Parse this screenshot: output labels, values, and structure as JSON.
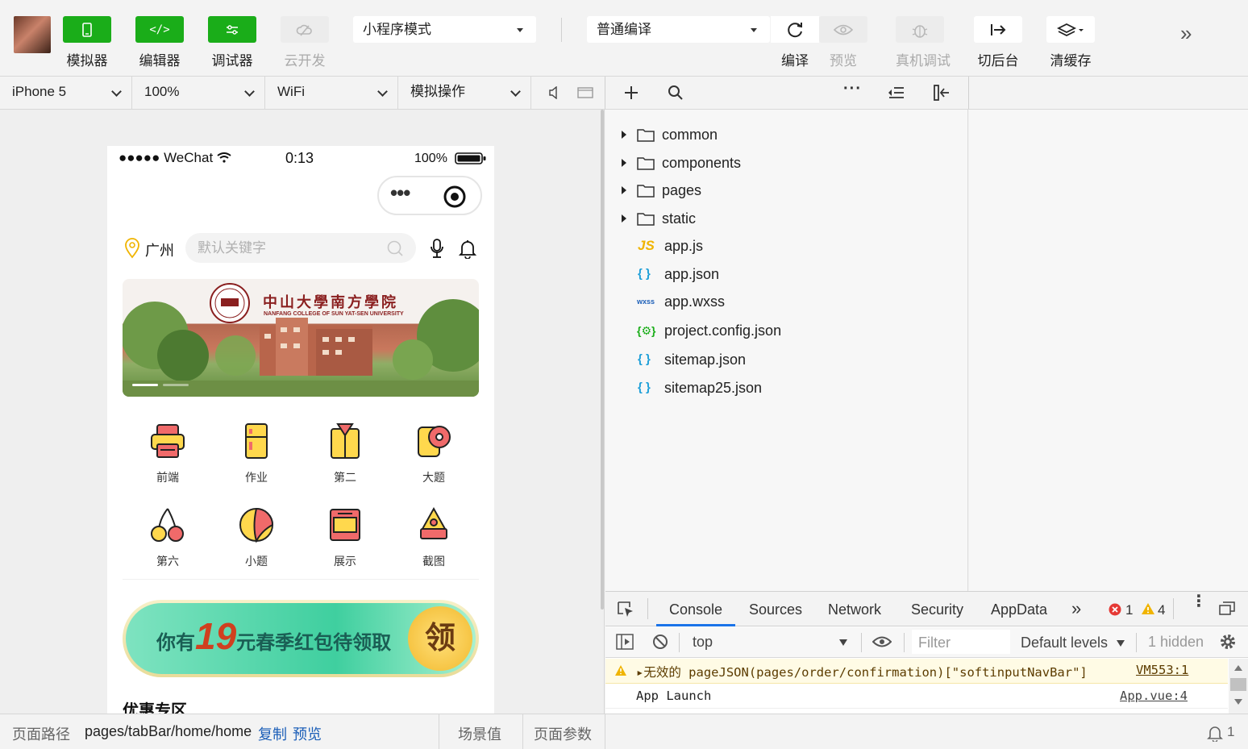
{
  "toolbar": {
    "simulator": "模拟器",
    "editor": "编辑器",
    "debugger": "调试器",
    "cloud": "云开发",
    "mode": "小程序模式",
    "compile_mode": "普通编译",
    "compile": "编译",
    "preview": "预览",
    "remote_debug": "真机调试",
    "background": "切后台",
    "clear_cache": "清缓存"
  },
  "simbar": {
    "device": "iPhone 5",
    "zoom": "100%",
    "network": "WiFi",
    "simulate": "模拟操作"
  },
  "phone": {
    "carrier": "●●●●● WeChat",
    "time": "0:13",
    "battery": "100%",
    "location": "广州",
    "search_placeholder": "默认关键字",
    "banner_title": "中山大學南方學院",
    "banner_subtitle": "NANFANG COLLEGE OF SUN YAT-SEN UNIVERSITY",
    "grid": [
      "前端",
      "作业",
      "第二",
      "大题",
      "第六",
      "小题",
      "展示",
      "截图"
    ],
    "redpack_prefix": "你有",
    "redpack_amount": "19",
    "redpack_suffix": "元春季红包待领取",
    "redpack_button": "领",
    "section_title": "优惠专区"
  },
  "tree": {
    "folders": [
      "common",
      "components",
      "pages",
      "static"
    ],
    "files": [
      {
        "name": "app.js",
        "icon": "JS"
      },
      {
        "name": "app.json",
        "icon": "{ }"
      },
      {
        "name": "app.wxss",
        "icon": "wxss"
      },
      {
        "name": "project.config.json",
        "icon": "{⚙}"
      },
      {
        "name": "sitemap.json",
        "icon": "{ }"
      },
      {
        "name": "sitemap25.json",
        "icon": "{ }"
      }
    ]
  },
  "console": {
    "tabs": [
      "Console",
      "Sources",
      "Network",
      "Security",
      "AppData"
    ],
    "more": "»",
    "error_count": "1",
    "warning_count": "4",
    "context": "top",
    "filter_placeholder": "Filter",
    "levels": "Default levels",
    "hidden": "1 hidden",
    "messages": [
      {
        "text": "▸无效的 pageJSON(pages/order/confirmation)[\"softinputNavBar\"]",
        "source": "VM553:1",
        "level": "warning"
      },
      {
        "text": "App Launch",
        "source": "App.vue:4",
        "level": "info"
      }
    ]
  },
  "bottom": {
    "path_label": "页面路径",
    "path": "pages/tabBar/home/home",
    "copy": "复制",
    "preview": "预览",
    "scene": "场景值",
    "params": "页面参数",
    "notifications": "1"
  },
  "colors": {
    "accent": "#1aad19",
    "warning": "#f0b400",
    "error": "#e53935",
    "link": "#1c5fb8"
  }
}
